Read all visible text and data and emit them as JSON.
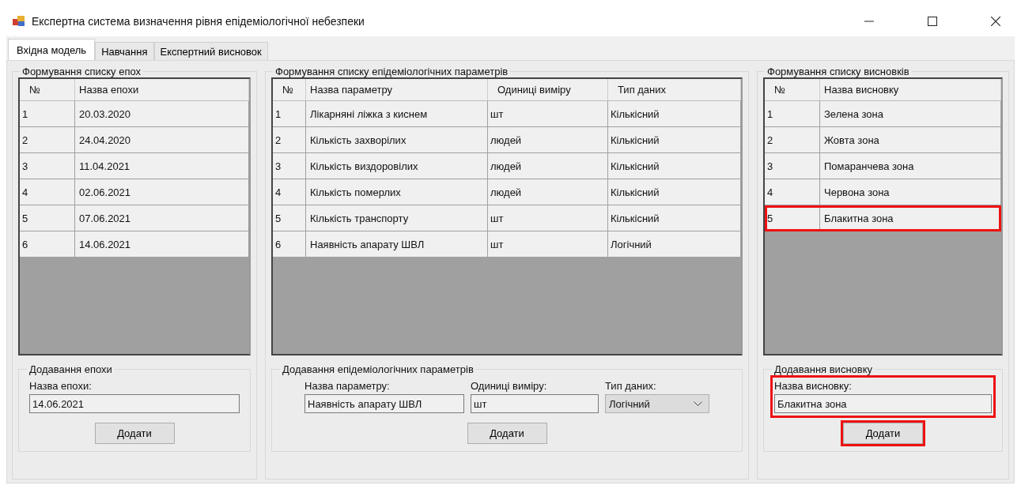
{
  "window": {
    "title": "Експертна система визначення рівня епідеміологічної небезпеки"
  },
  "tabs": [
    {
      "label": "Вхідна модель",
      "selected": true
    },
    {
      "label": "Навчання",
      "selected": false
    },
    {
      "label": "Експертний висновок",
      "selected": false
    }
  ],
  "epochs": {
    "title": "Формування списку епох",
    "columns": [
      "№",
      "Назва епохи"
    ],
    "rows": [
      {
        "cells": [
          "1",
          "20.03.2020"
        ],
        "highlighted": false
      },
      {
        "cells": [
          "2",
          "24.04.2020"
        ],
        "highlighted": false
      },
      {
        "cells": [
          "3",
          "11.04.2021"
        ],
        "highlighted": false
      },
      {
        "cells": [
          "4",
          "02.06.2021"
        ],
        "highlighted": false
      },
      {
        "cells": [
          "5",
          "07.06.2021"
        ],
        "highlighted": false
      },
      {
        "cells": [
          "6",
          "14.06.2021"
        ],
        "highlighted": false
      }
    ],
    "form": {
      "title": "Додавання епохи",
      "fields": [
        {
          "label": "Назва епохи:",
          "value": "14.06.2021",
          "kind": "text"
        }
      ],
      "button": "Додати",
      "highlighted": false,
      "button_highlighted": false
    }
  },
  "parameters": {
    "title": "Формування списку епідеміологічних параметрів",
    "columns": [
      "№",
      "Назва параметру",
      "Одиниці виміру",
      "Тип даних"
    ],
    "rows": [
      {
        "cells": [
          "1",
          "Лікарняні ліжка з киснем",
          "шт",
          "Кількісний"
        ],
        "highlighted": false
      },
      {
        "cells": [
          "2",
          "Кількість захворілих",
          "людей",
          "Кількісний"
        ],
        "highlighted": false
      },
      {
        "cells": [
          "3",
          "Кількість виздоровілих",
          "людей",
          "Кількісний"
        ],
        "highlighted": false
      },
      {
        "cells": [
          "4",
          "Кількість померлих",
          "людей",
          "Кількісний"
        ],
        "highlighted": false
      },
      {
        "cells": [
          "5",
          "Кількість транспорту",
          "шт",
          "Кількісний"
        ],
        "highlighted": false
      },
      {
        "cells": [
          "6",
          "Наявність апарату ШВЛ",
          "шт",
          "Логічний"
        ],
        "highlighted": false
      }
    ],
    "form": {
      "title": "Додавання епідеміологічних параметрів",
      "fields": [
        {
          "label": "Назва параметру:",
          "value": "Наявність апарату ШВЛ",
          "kind": "text"
        },
        {
          "label": "Одиниці виміру:",
          "value": "шт",
          "kind": "text"
        },
        {
          "label": "Тип даних:",
          "value": "Логічний",
          "kind": "dropdown"
        }
      ],
      "button": "Додати",
      "highlighted": false,
      "button_highlighted": false
    }
  },
  "conclusions": {
    "title": "Формування списку висновків",
    "columns": [
      "№",
      "Назва висновку"
    ],
    "rows": [
      {
        "cells": [
          "1",
          "Зелена зона"
        ],
        "highlighted": false
      },
      {
        "cells": [
          "2",
          "Жовта зона"
        ],
        "highlighted": false
      },
      {
        "cells": [
          "3",
          "Помаранчева зона"
        ],
        "highlighted": false
      },
      {
        "cells": [
          "4",
          "Червона зона"
        ],
        "highlighted": false
      },
      {
        "cells": [
          "5",
          "Блакитна зона"
        ],
        "highlighted": true
      }
    ],
    "form": {
      "title": "Додавання висновку",
      "fields": [
        {
          "label": "Назва висновку:",
          "value": "Блакитна зона",
          "kind": "text"
        }
      ],
      "button": "Додати",
      "highlighted": true,
      "button_highlighted": true
    }
  }
}
